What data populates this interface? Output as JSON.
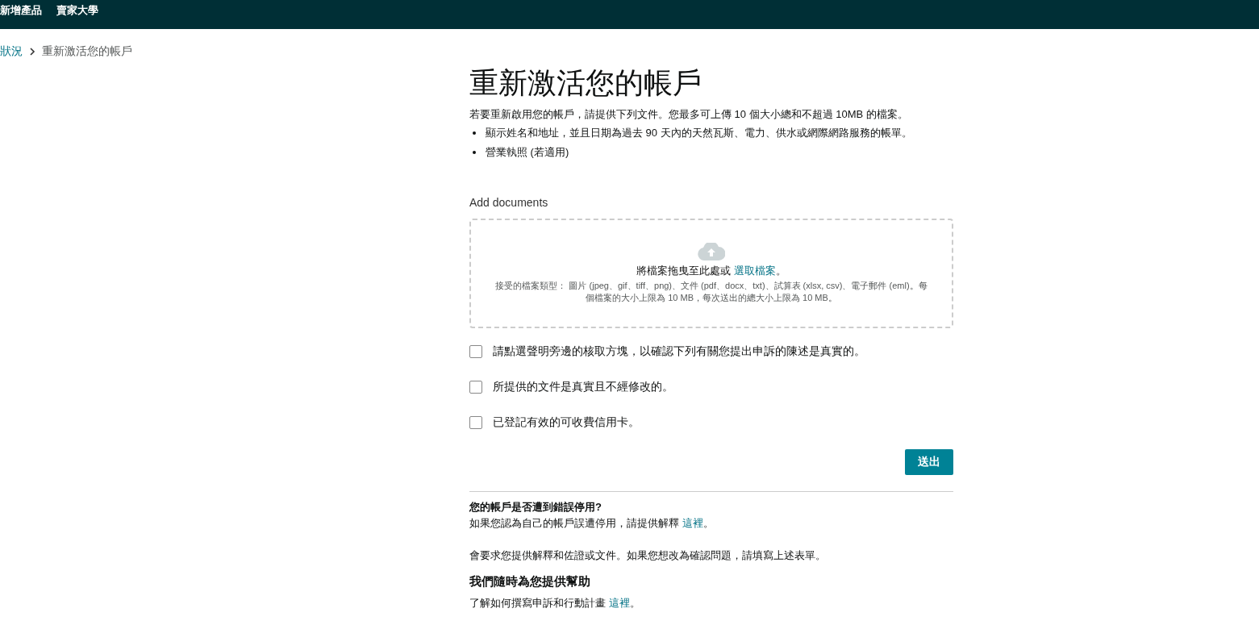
{
  "top_nav": {
    "items": [
      "新增產品",
      "賣家大學"
    ]
  },
  "breadcrumb": {
    "items": [
      "狀況",
      "重新激活您的帳戶"
    ]
  },
  "title": "重新激活您的帳戶",
  "intro": "若要重新啟用您的帳戶，請提供下列文件。您最多可上傳 10 個大小總和不超過 10MB 的檔案。",
  "requirements": [
    "顯示姓名和地址，並且日期為過去 90 天內的天然瓦斯、電力、供水或網際網路服務的帳單。",
    "營業執照 (若適用)"
  ],
  "upload": {
    "label": "Add documents",
    "prompt": "將檔案拖曳至此處或 ",
    "link": "選取檔案",
    "prompt_end": "。",
    "note": "接受的檔案類型： 圖片 (jpeg、gif、tiff、png)、文件 (pdf、docx、txt)、試算表 (xlsx, csv)、電子郵件 (eml)。每個檔案的大小上限為 10 MB，每次送出的總大小上限為 10 MB。"
  },
  "confirmations": [
    {
      "label": "請點選聲明旁邊的核取方塊，以確認下列有關您提出申訴的陳述是真實的。",
      "checked": false
    },
    {
      "label": "所提供的文件是真實且不經修改的。",
      "checked": false
    },
    {
      "label": "已登記有效的可收費信用卡。",
      "checked": false
    }
  ],
  "submit": "送出",
  "wrongly_deactivated": {
    "heading": "您的帳戶是否遭到錯誤停用?",
    "text": "如果您認為自己的帳戶誤遭停用，請提供解釋 ",
    "link": "這裡",
    "text_end": "。",
    "note": "會要求您提供解釋和佐證或文件。如果您想改為確認問題，請填寫上述表單。"
  },
  "help": {
    "heading": "我們隨時為您提供幫助",
    "text": "了解如何撰寫申訴和行動計畫 ",
    "link": "這裡",
    "text_end": "。"
  }
}
